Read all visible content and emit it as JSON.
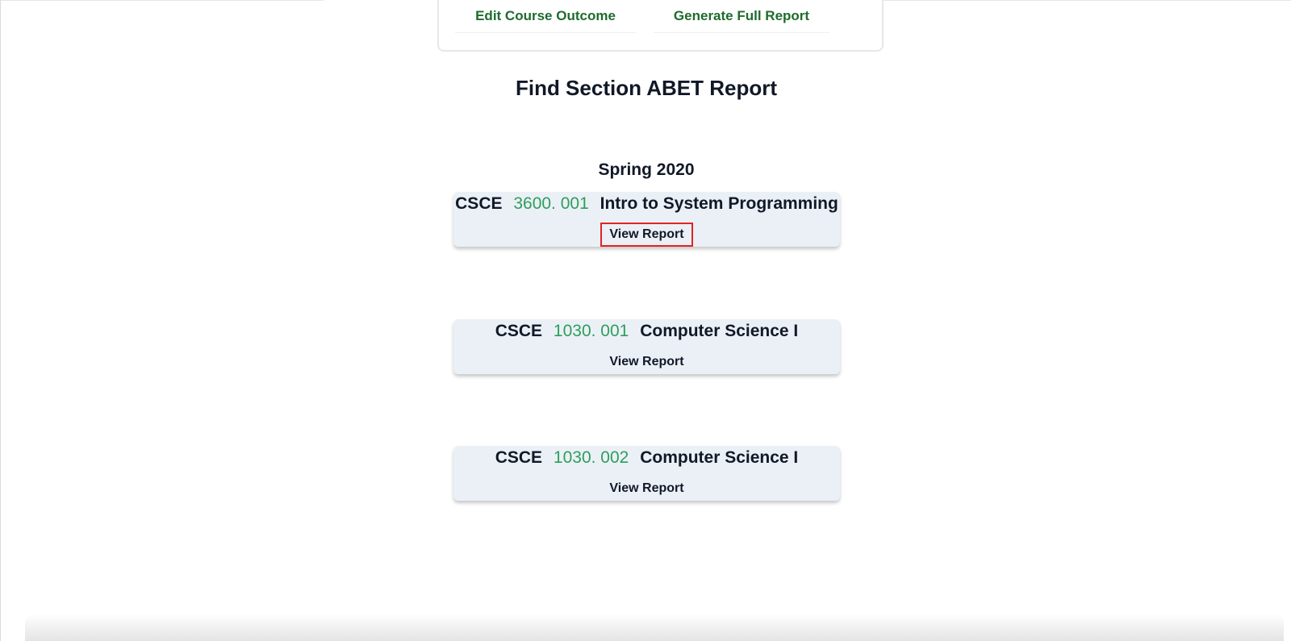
{
  "actions": {
    "edit_course_outcome": "Edit Course Outcome",
    "generate_full_report": "Generate Full Report"
  },
  "page_title": "Find Section ABET Report",
  "semester": "Spring 2020",
  "sections": [
    {
      "dept": "CSCE",
      "number": "3600. 001",
      "name": "Intro to System Programming",
      "button_label": "View Report",
      "highlighted": true
    },
    {
      "dept": "CSCE",
      "number": "1030. 001",
      "name": "Computer Science I",
      "button_label": "View Report",
      "highlighted": false
    },
    {
      "dept": "CSCE",
      "number": "1030. 002",
      "name": "Computer Science I",
      "button_label": "View Report",
      "highlighted": false
    }
  ],
  "colors": {
    "action_link": "#1e6b2e",
    "section_number": "#2e9e5b",
    "card_background": "#ebf0f6",
    "highlight_border": "#e02424"
  }
}
